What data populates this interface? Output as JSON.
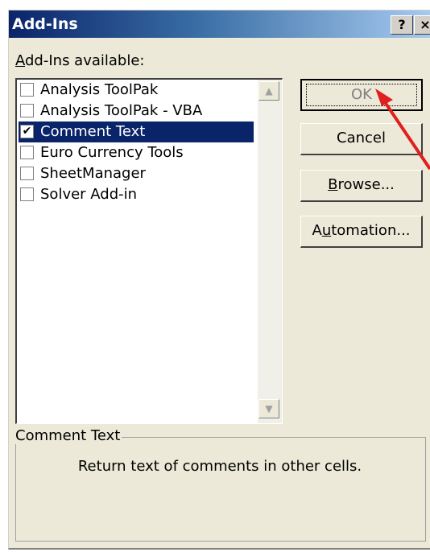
{
  "window": {
    "title": "Add-Ins",
    "help_glyph": "?",
    "close_glyph": "×"
  },
  "list": {
    "label": "Add-Ins available:",
    "items": [
      {
        "label": "Analysis ToolPak",
        "checked": false,
        "selected": false
      },
      {
        "label": "Analysis ToolPak - VBA",
        "checked": false,
        "selected": false
      },
      {
        "label": "Comment Text",
        "checked": true,
        "selected": true
      },
      {
        "label": "Euro Currency Tools",
        "checked": false,
        "selected": false
      },
      {
        "label": "SheetManager",
        "checked": false,
        "selected": false
      },
      {
        "label": "Solver Add-in",
        "checked": false,
        "selected": false
      }
    ],
    "check_glyph": "✔"
  },
  "buttons": {
    "ok": "OK",
    "cancel": "Cancel",
    "browse": "Browse...",
    "automation": "Automation..."
  },
  "description": {
    "legend": "Comment Text",
    "text": "Return text of comments in other cells."
  },
  "annotation": {
    "arrow_color": "#e02020"
  },
  "colors": {
    "title_bar": "#0a246a",
    "selection": "#0a246a",
    "dialog_bg": "#ece9d8"
  }
}
